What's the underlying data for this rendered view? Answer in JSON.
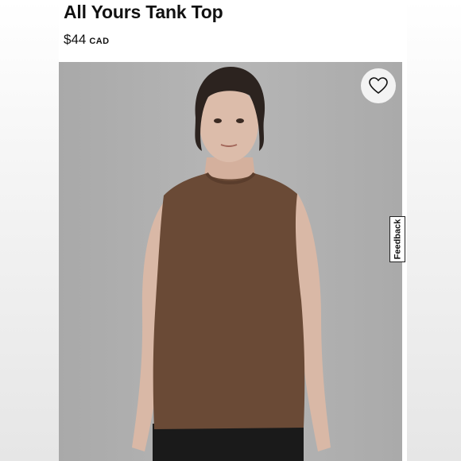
{
  "product": {
    "title": "All Yours Tank Top",
    "price": "$44",
    "currency": "CAD"
  },
  "actions": {
    "wishlist_icon": "heart-outline-icon",
    "feedback_label": "Feedback"
  },
  "colors": {
    "tank_top": "#6a4a36",
    "background": "#b0b0b0",
    "shorts": "#1a1a1a"
  }
}
